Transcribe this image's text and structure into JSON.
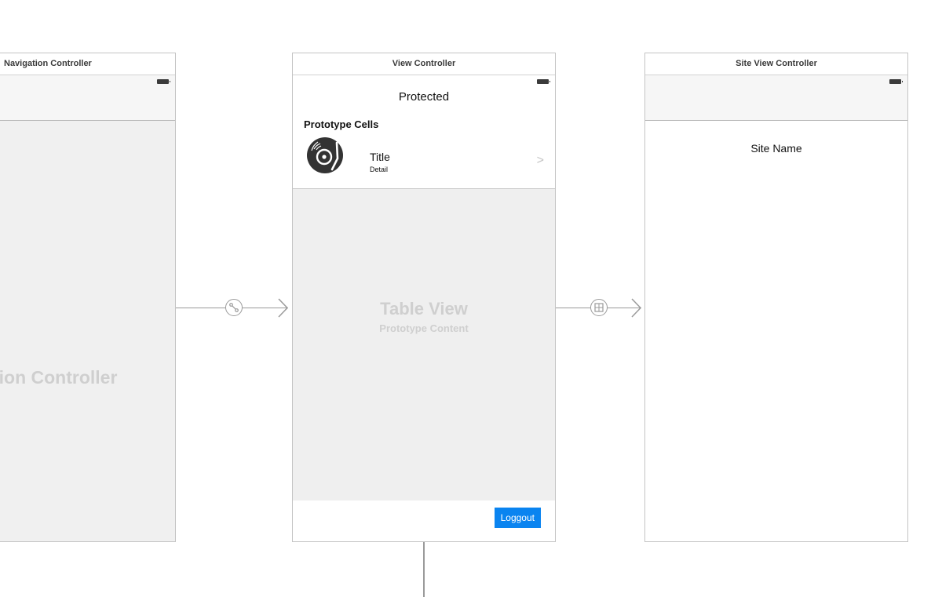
{
  "scenes": {
    "navigation": {
      "title": "Navigation Controller",
      "placeholder": "Navigation Controller"
    },
    "view_controller": {
      "title": "View Controller",
      "nav_title": "Protected",
      "prototype_header": "Prototype Cells",
      "cell": {
        "title": "Title",
        "detail": "Detail",
        "accessory": ">"
      },
      "table_view_label": "Table View",
      "table_view_sublabel": "Prototype Content",
      "logout_label": "Loggout"
    },
    "site_view_controller": {
      "title": "Site View Controller",
      "site_name_label": "Site Name"
    }
  },
  "segues": [
    {
      "from": "Navigation Controller",
      "to": "View Controller",
      "icon": "relationship-segue-icon"
    },
    {
      "from": "View Controller",
      "to": "Site View Controller",
      "icon": "show-segue-icon"
    }
  ],
  "colors": {
    "button_accent": "#0a84f0",
    "placeholder_text": "#cfcfcf",
    "scene_border": "#c4c4c4",
    "segue_line": "#9a9a9a"
  }
}
